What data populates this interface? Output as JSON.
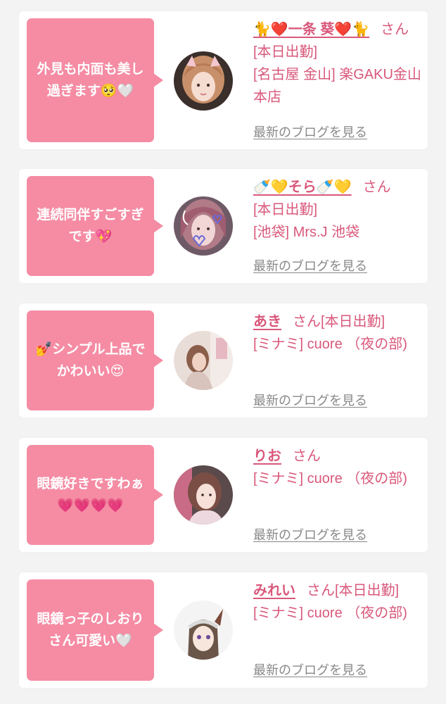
{
  "entries": [
    {
      "bubble": "外見も内面も美し\n過ぎます🥺🤍",
      "name": "🐈❤️一条 葵❤️🐈",
      "san": "さん",
      "status": "[本日出勤]",
      "shop": "[名古屋 金山] 楽GAKU金山本店",
      "blog": "最新のブログを見る"
    },
    {
      "bubble": "連続同伴すごすぎ\nです💖",
      "name": "🍼💛そら🍼💛",
      "san": "さん",
      "status": "[本日出勤]",
      "shop": "[池袋] Mrs.J 池袋",
      "blog": "最新のブログを見る"
    },
    {
      "bubble": "💅シンプル上品で\nかわいい😍",
      "name": "あき",
      "san": "さん[本日出勤]",
      "status": "",
      "shop": "[ミナミ] cuore （夜の部)",
      "blog": "最新のブログを見る"
    },
    {
      "bubble": "眼鏡好きですわぁ\n💗💗💗💗",
      "name": "りお",
      "san": "さん",
      "status": "",
      "shop": "[ミナミ] cuore （夜の部)",
      "blog": "最新のブログを見る"
    },
    {
      "bubble": "眼鏡っ子のしおり\nさん可愛い🤍",
      "name": "みれい",
      "san": "さん[本日出勤]",
      "status": "",
      "shop": "[ミナミ] cuore （夜の部)",
      "blog": "最新のブログを見る"
    }
  ],
  "colors": {
    "bubble": "#f58ca4",
    "accent_text": "#d9587b",
    "link": "#888888",
    "card": "#ffffff",
    "background": "#f3f3f3"
  }
}
